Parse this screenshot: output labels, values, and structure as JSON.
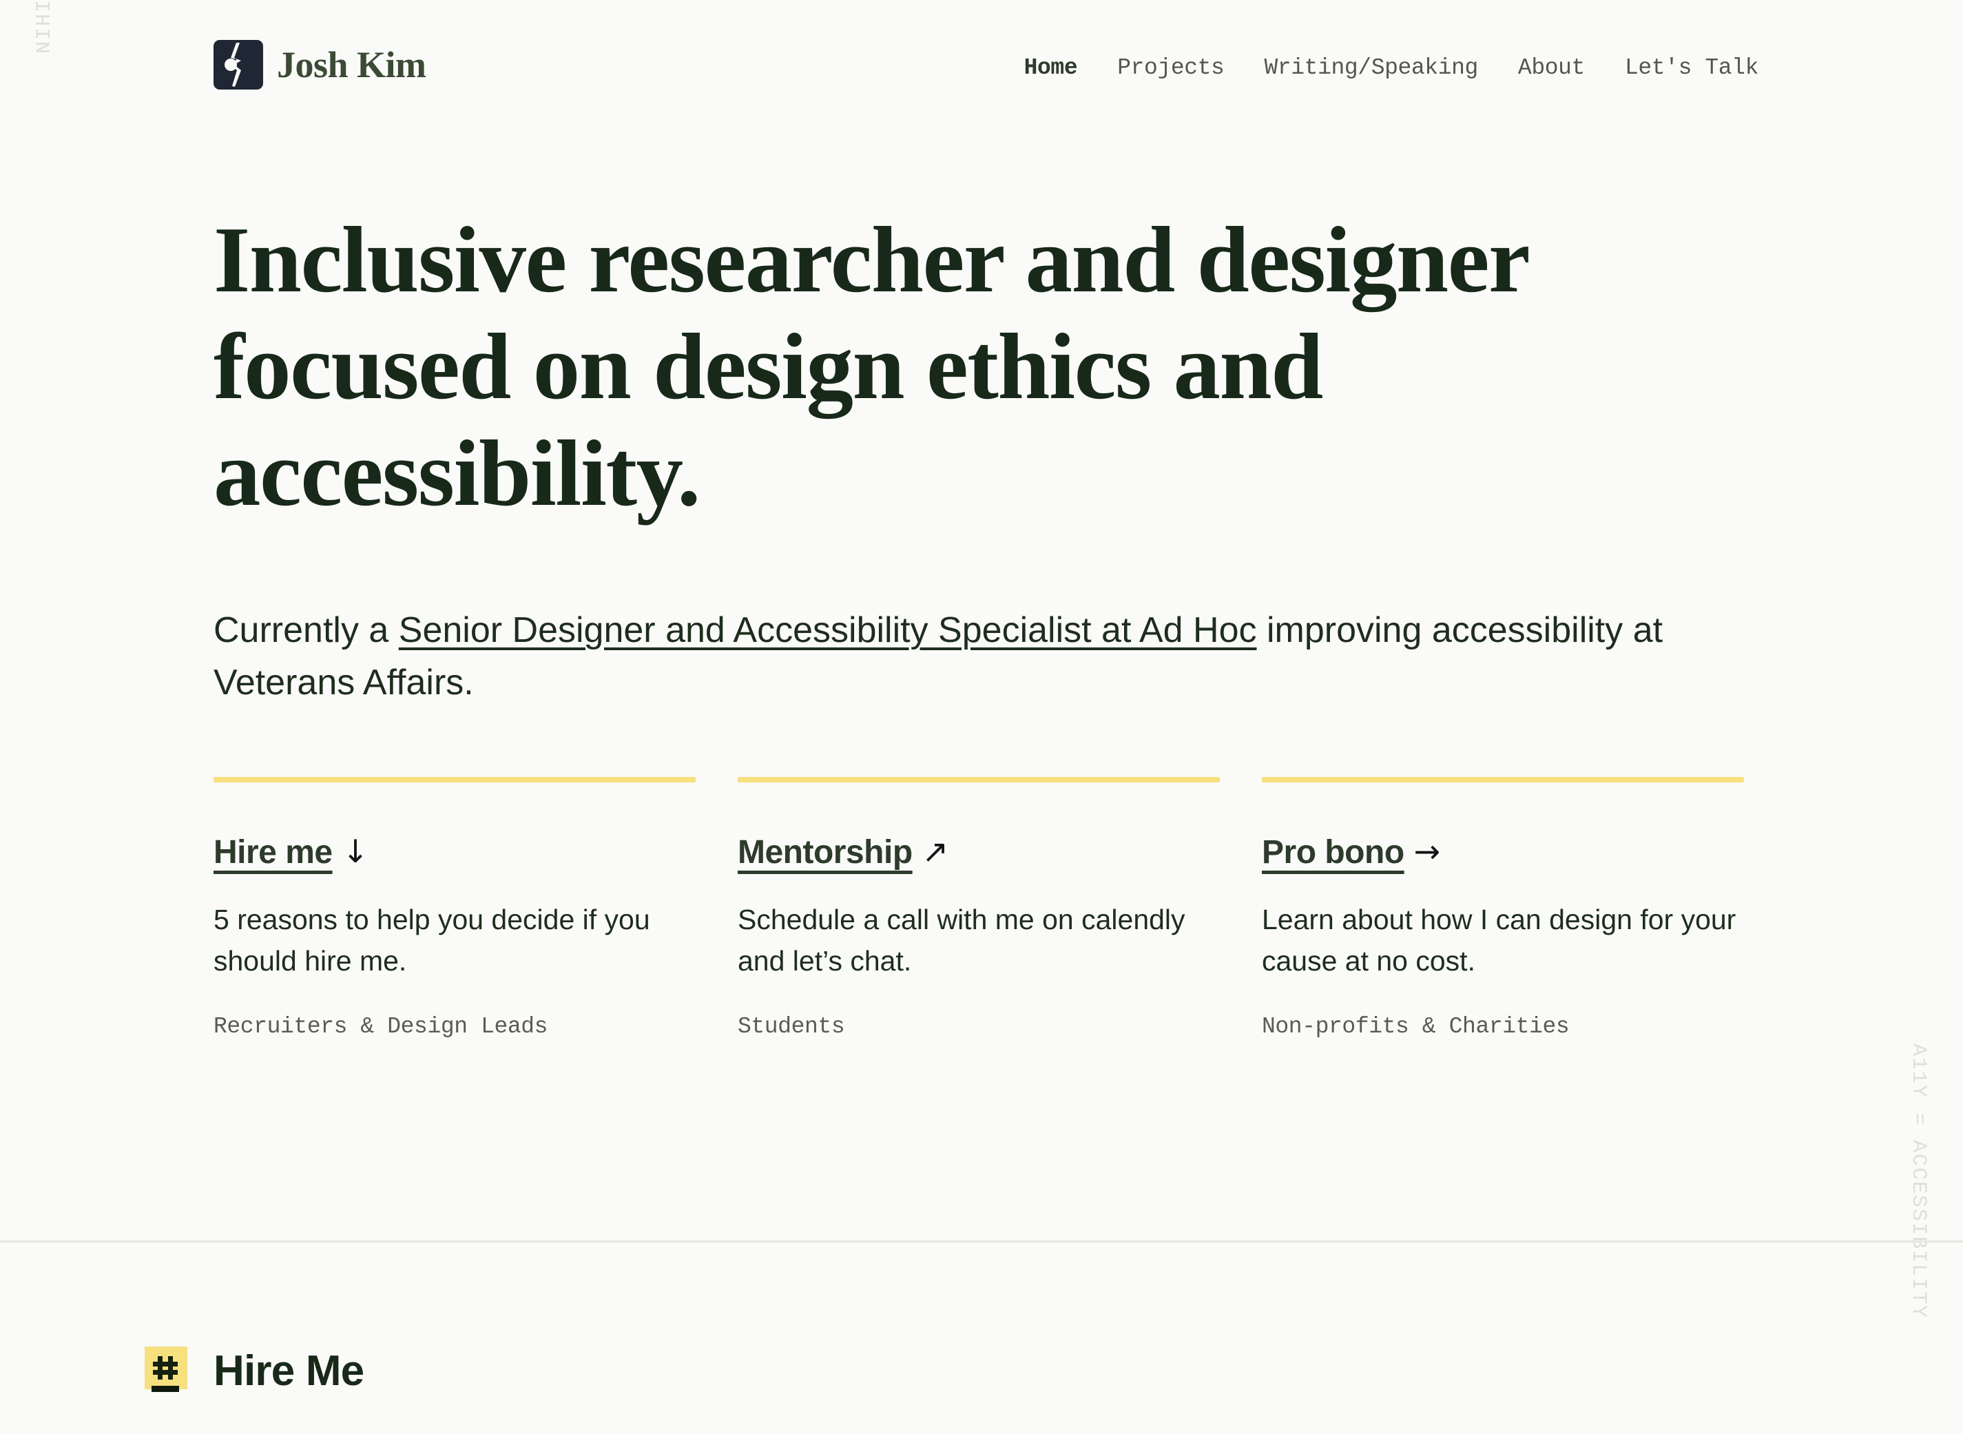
{
  "rails": {
    "left": "NIHIL DE NOBIS, SINE NOBIS",
    "right": "A11Y = ACCESSIBILITY"
  },
  "header": {
    "logo_icon": "josh-kim-logo-mark",
    "brand_name": "Josh Kim",
    "nav": [
      {
        "label": "Home",
        "active": true
      },
      {
        "label": "Projects",
        "active": false
      },
      {
        "label": "Writing/Speaking",
        "active": false
      },
      {
        "label": "About",
        "active": false
      },
      {
        "label": "Let's Talk",
        "active": false
      }
    ]
  },
  "hero": {
    "title": "Inclusive researcher and designer focused on design ethics and accessibility.",
    "subtitle_before": "Currently a ",
    "subtitle_link": "Senior Designer and Accessibility Specialist at Ad Hoc",
    "subtitle_after": " improving accessibility at Veterans Affairs."
  },
  "cards": [
    {
      "label": "Hire me ",
      "arrow": "↓",
      "arrow_icon": "arrow-down-icon",
      "description": "5 reasons to help you decide if you should hire me.",
      "audience": "Recruiters & Design Leads"
    },
    {
      "label": "Mentorship ",
      "arrow": "↗",
      "arrow_icon": "arrow-up-right-icon",
      "description": "Schedule a call with me on calendly and let’s chat.",
      "audience": "Students"
    },
    {
      "label": "Pro bono ",
      "arrow": "→",
      "arrow_icon": "arrow-right-icon",
      "description": "Learn about how I can design for your cause at no cost.",
      "audience": "Non-profits & Charities"
    }
  ],
  "hire_section": {
    "icon": "hash-badge-icon",
    "title": "Hire Me"
  },
  "colors": {
    "background": "#FAFAF8",
    "ink": "#18291A",
    "accent_yellow": "#F7E07E",
    "logo_navy": "#1E2733",
    "muted": "#5A5A56",
    "rail": "#DEDEDA",
    "divider": "#E7E7E4"
  }
}
